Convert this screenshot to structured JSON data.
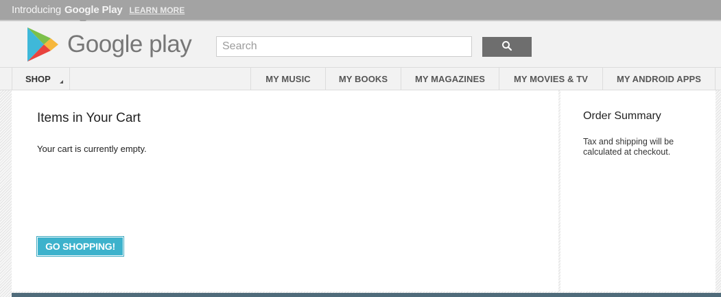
{
  "promo": {
    "intro": "Introducing",
    "brand": "Google Play",
    "learn_more": "LEARN MORE"
  },
  "header": {
    "logo_text": "Google play",
    "search_placeholder": "Search",
    "search_value": "",
    "search_button_icon": "magnifier-icon"
  },
  "nav": {
    "shop": "SHOP",
    "items": [
      "MY MUSIC",
      "MY BOOKS",
      "MY MAGAZINES",
      "MY MOVIES & TV",
      "MY ANDROID APPS"
    ]
  },
  "cart": {
    "title": "Items in Your Cart",
    "empty_message": "Your cart is currently empty.",
    "go_shopping": "GO SHOPPING!"
  },
  "summary": {
    "title": "Order Summary",
    "note": "Tax and shipping will be calculated at checkout."
  },
  "colors": {
    "promo_bar": "#a3a3a3",
    "accent_button": "#3db2cc",
    "search_button": "#6e6e6e"
  }
}
